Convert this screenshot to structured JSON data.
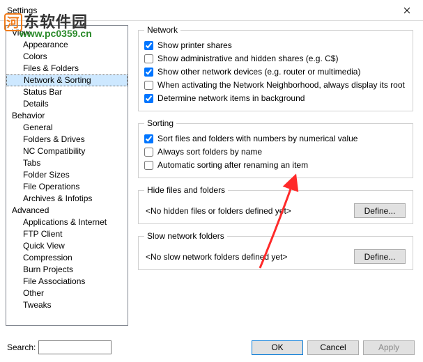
{
  "window": {
    "title": "Settings"
  },
  "watermark": {
    "line1_box": "河",
    "line1_rest": "东软件园",
    "line2": "www.pc0359.cn"
  },
  "sidebar": {
    "view_label": "View",
    "items": [
      {
        "label": "View",
        "cat": true
      },
      {
        "label": "Appearance"
      },
      {
        "label": "Colors"
      },
      {
        "label": "Files & Folders"
      },
      {
        "label": "Network & Sorting",
        "selected": true
      },
      {
        "label": "Status Bar"
      },
      {
        "label": "Details"
      },
      {
        "label": "Behavior",
        "cat": true
      },
      {
        "label": "General"
      },
      {
        "label": "Folders & Drives"
      },
      {
        "label": "NC Compatibility"
      },
      {
        "label": "Tabs"
      },
      {
        "label": "Folder Sizes"
      },
      {
        "label": "File Operations"
      },
      {
        "label": "Archives & Infotips"
      },
      {
        "label": "Advanced",
        "cat": true
      },
      {
        "label": "Applications & Internet"
      },
      {
        "label": "FTP Client"
      },
      {
        "label": "Quick View"
      },
      {
        "label": "Compression"
      },
      {
        "label": "Burn Projects"
      },
      {
        "label": "File Associations"
      },
      {
        "label": "Other"
      },
      {
        "label": "Tweaks"
      }
    ]
  },
  "groups": {
    "network": {
      "legend": "Network",
      "cb": [
        {
          "label": "Show printer shares",
          "checked": true
        },
        {
          "label": "Show administrative and hidden shares (e.g. C$)",
          "checked": false
        },
        {
          "label": "Show other network devices (e.g. router or multimedia)",
          "checked": true
        },
        {
          "label": "When activating the Network Neighborhood, always display its root",
          "checked": false
        },
        {
          "label": "Determine network items in background",
          "checked": true
        }
      ]
    },
    "sorting": {
      "legend": "Sorting",
      "cb": [
        {
          "label": "Sort files and folders with numbers by numerical value",
          "checked": true
        },
        {
          "label": "Always sort folders by name",
          "checked": false
        },
        {
          "label": "Automatic sorting after renaming an item",
          "checked": false
        }
      ]
    },
    "hide": {
      "legend": "Hide files and folders",
      "info": "<No hidden files or folders defined yet>",
      "btn": "Define..."
    },
    "slow": {
      "legend": "Slow network folders",
      "info": "<No slow network folders defined yet>",
      "btn": "Define..."
    }
  },
  "footer": {
    "search_label": "Search:",
    "search_value": "",
    "ok": "OK",
    "cancel": "Cancel",
    "apply": "Apply"
  }
}
